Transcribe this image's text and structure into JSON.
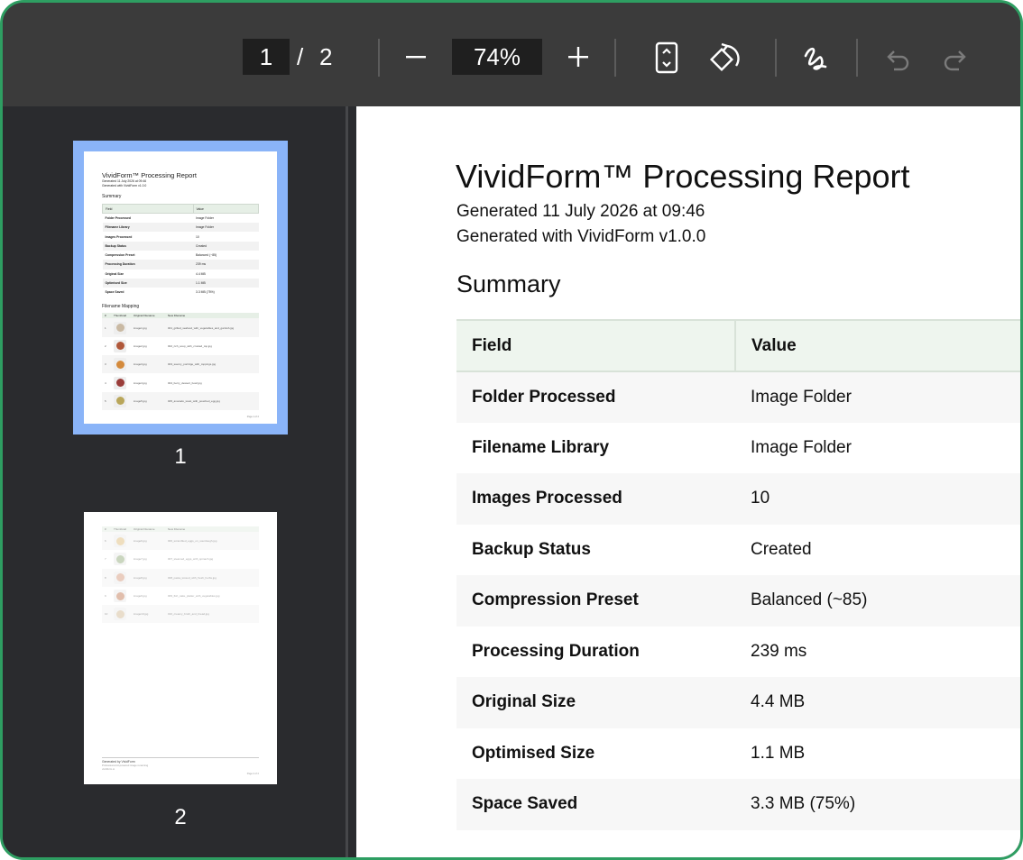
{
  "toolbar": {
    "current_page": "1",
    "page_separator": "/",
    "total_pages": "2",
    "zoom": "74%",
    "icons": [
      "zoom-out-icon",
      "zoom-in-icon",
      "fit-page-icon",
      "rotate-icon",
      "draw-icon",
      "undo-icon",
      "redo-icon"
    ]
  },
  "sidebar": {
    "thumbnails": [
      {
        "label": "1",
        "selected": true
      },
      {
        "label": "2",
        "selected": false
      }
    ],
    "thumb1": {
      "title": "VividForm™ Processing Report",
      "sub1": "Generated 11 July 2026 at 09:46",
      "sub2": "Generated with VividForm v1.0.0",
      "summary": "Summary",
      "mapping_title": "Filename Mapping",
      "mapping_headers": [
        "#",
        "Thumbnail",
        "Original Filename",
        "New Filename"
      ],
      "mapping_rows": [
        {
          "n": "1",
          "orig": "image1.jpg",
          "new": "001_grilled_seafood_with_vegetables_and_garnish.jpg"
        },
        {
          "n": "2",
          "orig": "image2.jpg",
          "new": "002_rich_soup_with_crusted_top.jpg"
        },
        {
          "n": "3",
          "orig": "image3.jpg",
          "new": "003_savory_porridge_with_toppings.jpg"
        },
        {
          "n": "4",
          "orig": "image4.jpg",
          "new": "004_berry_dessert_bowl.jpg"
        },
        {
          "n": "5",
          "orig": "image5.jpg",
          "new": "005_avocado_toast_with_poached_egg.jpg"
        }
      ],
      "footer": "Page 1 of 2"
    },
    "thumb2": {
      "mapping_headers": [
        "#",
        "Thumbnail",
        "Original Filename",
        "New Filename"
      ],
      "mapping_rows": [
        {
          "n": "6",
          "orig": "image6.jpg",
          "new": "006_scrambled_eggs_on_sourdough.jpg"
        },
        {
          "n": "7",
          "orig": "image7.jpg",
          "new": "007_steamed_eggs_with_spinach.jpg"
        },
        {
          "n": "8",
          "orig": "image8.jpg",
          "new": "008_pasta_tossed_with_fresh_herbs.jpg"
        },
        {
          "n": "9",
          "orig": "image9.jpg",
          "new": "009_fish_cake_platter_with_vegetables.jpg"
        },
        {
          "n": "10",
          "orig": "image10.jpg",
          "new": "010_creamy_broth_and_bread.jpg"
        }
      ],
      "footer_line1": "Generated by VividForm",
      "footer_line2": "Professional AI-powered image renaming",
      "footer_line3": "vividform.io",
      "footer_page": "Page 2 of 2"
    }
  },
  "document": {
    "title": "VividForm™ Processing Report",
    "generated_at": "Generated 11 July 2026 at 09:46",
    "generated_with": "Generated with VividForm v1.0.0",
    "section_summary": "Summary",
    "table_headers": {
      "field": "Field",
      "value": "Value"
    },
    "rows": [
      {
        "field": "Folder Processed",
        "value": "Image Folder"
      },
      {
        "field": "Filename Library",
        "value": "Image Folder"
      },
      {
        "field": "Images Processed",
        "value": "10"
      },
      {
        "field": "Backup Status",
        "value": "Created"
      },
      {
        "field": "Compression Preset",
        "value": "Balanced (~85)"
      },
      {
        "field": "Processing Duration",
        "value": "239 ms"
      },
      {
        "field": "Original Size",
        "value": "4.4 MB"
      },
      {
        "field": "Optimised Size",
        "value": "1.1 MB"
      },
      {
        "field": "Space Saved",
        "value": "3.3 MB (75%)"
      }
    ]
  },
  "colors": {
    "frame_border": "#2e9e62",
    "toolbar_bg": "#3b3b3b",
    "sidebar_bg": "#2a2b2e",
    "thumb_selected": "#8ab4f8",
    "table_header_bg": "#eef5ee"
  }
}
